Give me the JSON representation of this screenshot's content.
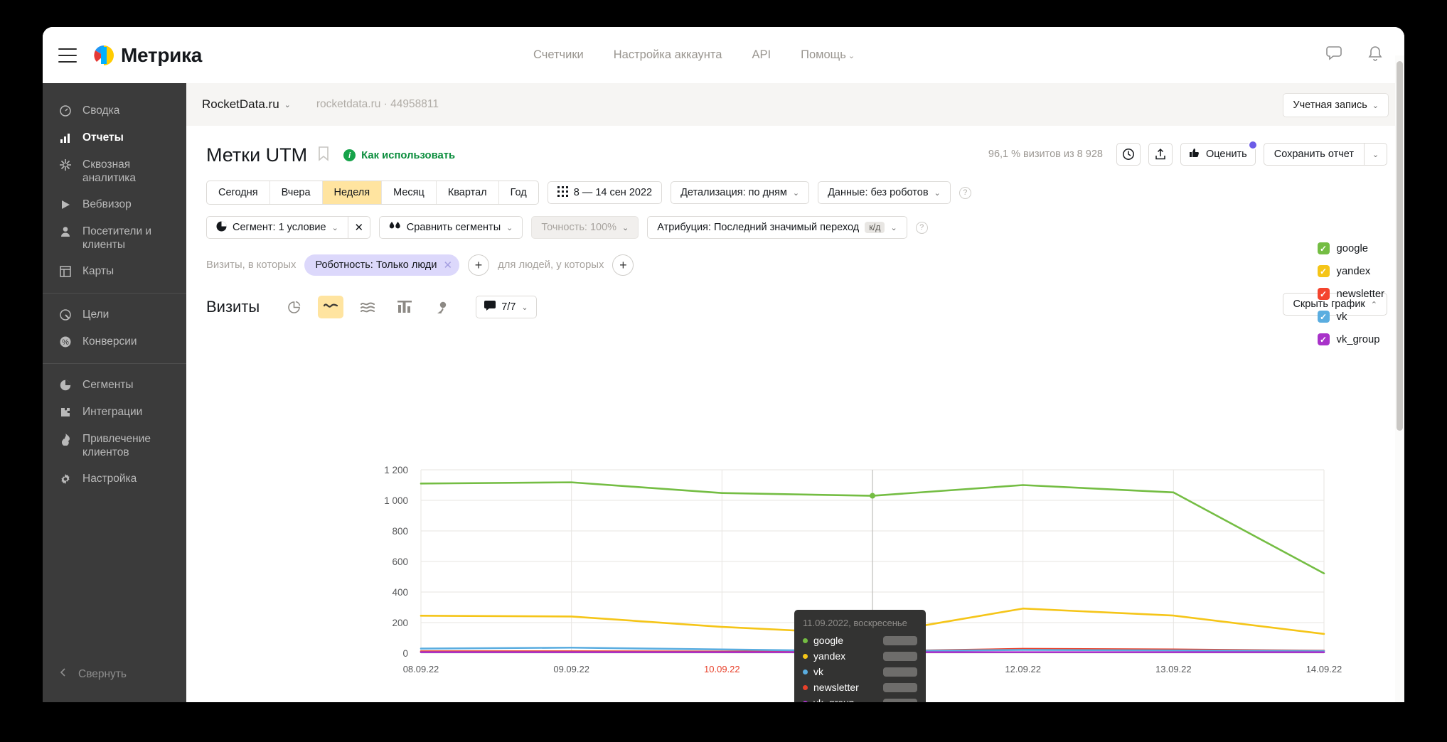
{
  "topnav": {
    "items": [
      {
        "label": "Счетчики"
      },
      {
        "label": "Настройка аккаунта"
      },
      {
        "label": "API"
      },
      {
        "label": "Помощь",
        "caret": "⌄"
      }
    ],
    "logo_text": "Метрика"
  },
  "sidebar": {
    "items": [
      {
        "label": "Сводка",
        "icon": "gauge-icon",
        "active": false
      },
      {
        "label": "Отчеты",
        "icon": "bar-chart-icon",
        "active": true
      },
      {
        "label": "Сквозная аналитика",
        "icon": "snowflake-icon",
        "active": false
      },
      {
        "label": "Вебвизор",
        "icon": "play-icon",
        "active": false
      },
      {
        "label": "Посетители и клиенты",
        "icon": "person-icon",
        "active": false
      },
      {
        "label": "Карты",
        "icon": "layout-icon",
        "active": false
      },
      {
        "label": "Цели",
        "icon": "target-icon",
        "active": false
      },
      {
        "label": "Конверсии",
        "icon": "percent-icon",
        "active": false
      },
      {
        "label": "Сегменты",
        "icon": "pie-icon",
        "active": false
      },
      {
        "label": "Интеграции",
        "icon": "puzzle-icon",
        "active": false
      },
      {
        "label": "Привлечение клиентов",
        "icon": "flame-icon",
        "active": false
      },
      {
        "label": "Настройка",
        "icon": "gear-icon",
        "active": false
      }
    ],
    "collapse_label": "Свернуть"
  },
  "breadcrumb": {
    "site": "RocketData.ru",
    "caret": "⌄",
    "sub": "rocketdata.ru · 44958811",
    "account_button": "Учетная запись",
    "account_caret": "⌄"
  },
  "header": {
    "title": "Метки UTM",
    "howto": "Как использовать",
    "visits_stat": "96,1 % визитов из 8 928",
    "rate_label": "Оценить",
    "save_label": "Сохранить отчет",
    "save_caret": "⌄"
  },
  "daterange": {
    "tabs": [
      {
        "label": "Сегодня",
        "selected": false
      },
      {
        "label": "Вчера",
        "selected": false
      },
      {
        "label": "Неделя",
        "selected": true
      },
      {
        "label": "Месяц",
        "selected": false
      },
      {
        "label": "Квартал",
        "selected": false
      },
      {
        "label": "Год",
        "selected": false
      }
    ],
    "date_value": "8 — 14 сен 2022",
    "detail": "Детализация: по дням",
    "data_mode": "Данные: без роботов"
  },
  "segments": {
    "segment": "Сегмент: 1 условие",
    "compare": "Сравнить сегменты",
    "accuracy": "Точность: 100%",
    "attribution": "Атрибуция: Последний значимый переход",
    "attribution_chip": "к/д"
  },
  "visit_filter": {
    "prefix": "Визиты, в которых",
    "chip": "Роботность: Только люди",
    "middle": "для людей, у которых"
  },
  "chart_toolbar": {
    "title": "Визиты",
    "types": [
      {
        "icon": "pie-chart-icon",
        "active": false
      },
      {
        "icon": "line-chart-icon",
        "active": true
      },
      {
        "icon": "area-chart-icon",
        "active": false
      },
      {
        "icon": "column-chart-icon",
        "active": false
      },
      {
        "icon": "map-pin-icon",
        "active": false
      }
    ],
    "count": "7/7",
    "count_caret": "⌄",
    "hide_label": "Скрыть график",
    "hide_caret": "⌃"
  },
  "tooltip": {
    "date": "11.09.2022, воскресенье",
    "rows": [
      {
        "name": "google",
        "color": "#74bd43"
      },
      {
        "name": "yandex",
        "color": "#f5c518"
      },
      {
        "name": "vk",
        "color": "#5aade0"
      },
      {
        "name": "newsletter",
        "color": "#e8402a"
      },
      {
        "name": "vk_group",
        "color": "#a832c9"
      }
    ]
  },
  "chart_data": {
    "type": "line",
    "title": "Визиты",
    "xlabel": "",
    "ylabel": "",
    "ylim": [
      0,
      1200
    ],
    "yticks": [
      0,
      200,
      400,
      600,
      800,
      1000,
      1200
    ],
    "ytick_labels": [
      "0",
      "200",
      "400",
      "600",
      "800",
      "1 000",
      "1 200"
    ],
    "grid": true,
    "legend_position": "right",
    "categories": [
      "08.09.22",
      "09.09.22",
      "10.09.22",
      "11.09.22",
      "12.09.22",
      "13.09.22",
      "14.09.22"
    ],
    "weekend_ticks": [
      "10.09.22",
      "11.09.22"
    ],
    "highlighted_index": 3,
    "series": [
      {
        "name": "google",
        "color": "#74bd43",
        "values": [
          1110,
          1118,
          1048,
          1030,
          1100,
          1052,
          522
        ]
      },
      {
        "name": "yandex",
        "color": "#f5c518",
        "values": [
          245,
          240,
          172,
          124,
          292,
          246,
          126
        ]
      },
      {
        "name": "newsletter",
        "color": "#e8402a",
        "values": [
          12,
          12,
          10,
          12,
          28,
          24,
          16
        ]
      },
      {
        "name": "vk",
        "color": "#5aade0",
        "values": [
          30,
          36,
          24,
          13,
          21,
          18,
          14
        ]
      },
      {
        "name": "vk_group",
        "color": "#a832c9",
        "values": [
          6,
          6,
          6,
          6,
          6,
          6,
          6
        ]
      }
    ]
  },
  "legend": {
    "items": [
      {
        "label": "google",
        "color": "#74bd43",
        "checked": true
      },
      {
        "label": "yandex",
        "color": "#f5c518",
        "checked": true
      },
      {
        "label": "newsletter",
        "color": "#f4442e",
        "checked": true
      },
      {
        "label": "vk",
        "color": "#5aade0",
        "checked": true
      },
      {
        "label": "vk_group",
        "color": "#a832c9",
        "checked": true
      }
    ],
    "check_glyph": "✓"
  }
}
